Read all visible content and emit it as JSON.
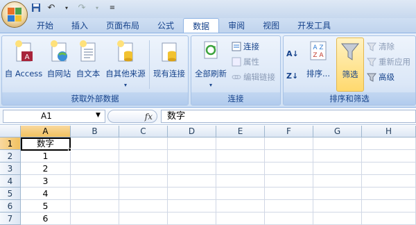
{
  "qat": {
    "save_icon": "save-icon",
    "undo_icon": "undo-icon",
    "redo_icon": "redo-icon"
  },
  "tabs": [
    "开始",
    "插入",
    "页面布局",
    "公式",
    "数据",
    "审阅",
    "视图",
    "开发工具"
  ],
  "active_tab": "数据",
  "groups": {
    "external": {
      "label": "获取外部数据",
      "access": "自 Access",
      "web": "自网站",
      "text": "自文本",
      "other": "自其他来源",
      "existing": "现有连接"
    },
    "connections": {
      "label": "连接",
      "refresh_all": "全部刷新",
      "connections": "连接",
      "properties": "属性",
      "edit_links": "编辑链接"
    },
    "sort_filter": {
      "label": "排序和筛选",
      "sort": "排序...",
      "filter": "筛选",
      "clear": "清除",
      "reapply": "重新应用",
      "advanced": "高级"
    }
  },
  "formula_bar": {
    "name_box": "A1",
    "fx": "fx",
    "content": "数字"
  },
  "columns": [
    "A",
    "B",
    "C",
    "D",
    "E",
    "F",
    "G",
    "H"
  ],
  "rows": [
    {
      "num": "1",
      "a": "数字"
    },
    {
      "num": "2",
      "a": "1"
    },
    {
      "num": "3",
      "a": "2"
    },
    {
      "num": "4",
      "a": "3"
    },
    {
      "num": "5",
      "a": "4"
    },
    {
      "num": "6",
      "a": "5"
    },
    {
      "num": "7",
      "a": "6"
    }
  ],
  "colors": {
    "accent": "#15428b",
    "ribbon": "#dbe7f7",
    "selection": "#f1c15f"
  }
}
